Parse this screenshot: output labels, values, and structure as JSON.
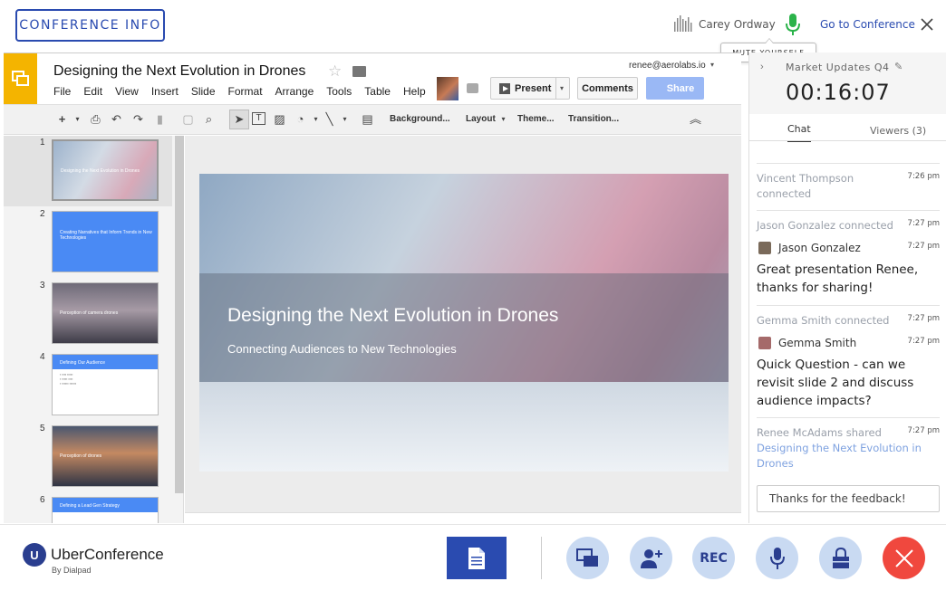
{
  "topbar": {
    "conference_info_label": "CONFERENCE INFO",
    "speaker_name": "Carey Ordway",
    "goto_label": "Go to Conference",
    "mute_tooltip": "MUTE YOURSELF",
    "mic_color": "#2bb34a"
  },
  "slides_app": {
    "doc_title": "Designing the Next Evolution in Drones",
    "menu": [
      "File",
      "Edit",
      "View",
      "Insert",
      "Slide",
      "Format",
      "Arrange",
      "Tools",
      "Table",
      "Help"
    ],
    "email": "renee@aerolabs.io",
    "present_label": "Present",
    "comments_label": "Comments",
    "share_label": "Share",
    "toolbar": {
      "background_label": "Background...",
      "layout_label": "Layout",
      "theme_label": "Theme...",
      "transition_label": "Transition..."
    },
    "thumbnails": [
      {
        "num": "1",
        "title": "Designing the Next Evolution in Drones"
      },
      {
        "num": "2",
        "title": "Creating Narratives that Inform Trends in New Technologies"
      },
      {
        "num": "3",
        "title": "Perception of camera drones"
      },
      {
        "num": "4",
        "title": "Defining Our Audience"
      },
      {
        "num": "5",
        "title": "Perception of drones"
      },
      {
        "num": "6",
        "title": "Defining a Lead Gen Strategy"
      }
    ],
    "main_slide": {
      "title": "Designing the Next Evolution in Drones",
      "subtitle": "Connecting Audiences to New Technologies"
    }
  },
  "panel": {
    "meeting_name": "Market Updates Q4",
    "timer": "00:16:07",
    "tab_chat": "Chat",
    "tab_viewers": "Viewers (3)",
    "messages": [
      {
        "kind": "system",
        "text": "Vincent Thompson connected",
        "time": "7:26 pm"
      },
      {
        "kind": "system",
        "text": "Jason Gonzalez connected",
        "time": "7:27 pm"
      },
      {
        "kind": "user",
        "name": "Jason Gonzalez",
        "text": "Great presentation Renee, thanks for sharing!",
        "time": "7:27 pm"
      },
      {
        "kind": "system",
        "text": "Gemma Smith connected",
        "time": "7:27 pm"
      },
      {
        "kind": "user",
        "name": "Gemma Smith",
        "text": "Quick Question - can we revisit slide 2 and discuss audience impacts?",
        "time": "7:27 pm"
      },
      {
        "kind": "system",
        "text": "Renee McAdams shared",
        "link": "Designing the Next Evolution in Drones",
        "time": "7:27 pm"
      }
    ],
    "input_value": "Thanks for the feedback!"
  },
  "bottombar": {
    "brand": "UberConference",
    "brand_sub": "By Dialpad",
    "rec_label": "REC",
    "accent": "#2a4bb0",
    "hangup_color": "#f0483e"
  }
}
